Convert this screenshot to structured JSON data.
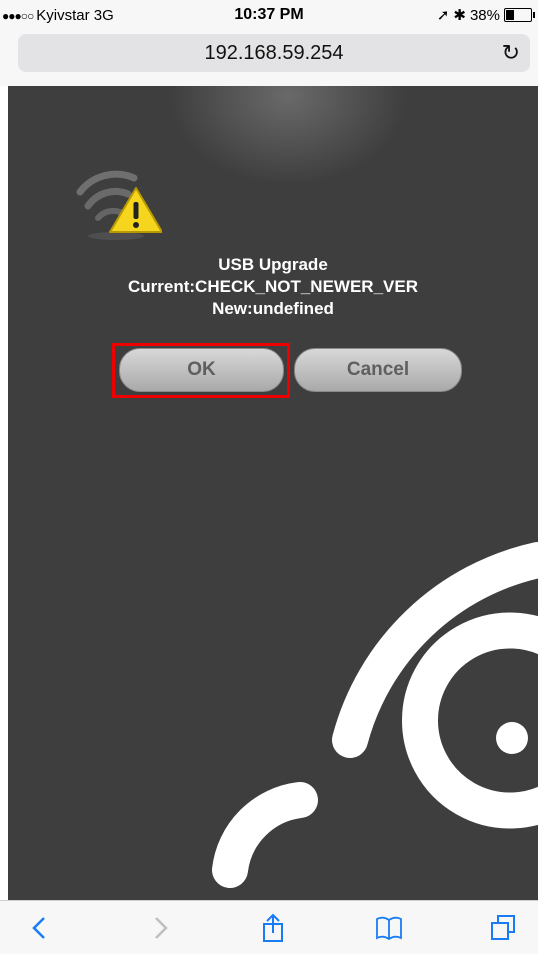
{
  "status_bar": {
    "signal": "●●●○○",
    "carrier": "Kyivstar  3G",
    "time": "10:37 PM",
    "battery_pct": "38%",
    "battery_level": 0.38
  },
  "address_bar": {
    "url": "192.168.59.254"
  },
  "dialog": {
    "title": "USB Upgrade",
    "current": "Current:CHECK_NOT_NEWER_VER",
    "new": "New:undefined",
    "ok_label": "OK",
    "cancel_label": "Cancel"
  },
  "icons": [
    "location-arrow-icon",
    "bluetooth-icon",
    "reload-icon",
    "warning-icon",
    "back-icon",
    "forward-icon",
    "share-icon",
    "bookmarks-icon",
    "tabs-icon"
  ],
  "colors": {
    "page_bg": "#3e3e3e",
    "highlight": "#e00000",
    "ios_blue": "#1a7cf5"
  }
}
